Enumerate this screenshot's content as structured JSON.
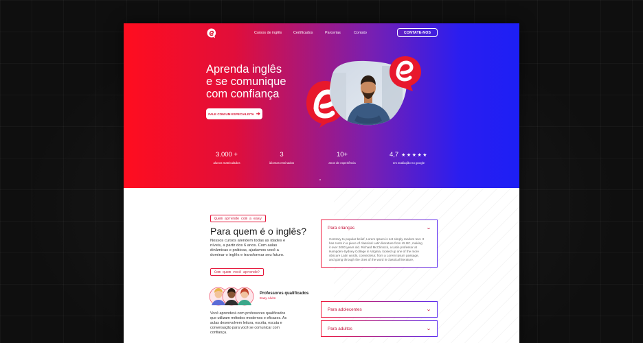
{
  "nav": {
    "links": [
      "Cursos de inglês",
      "Certificados",
      "Parcerias",
      "Contato"
    ],
    "cta": "CONTATE-NOS"
  },
  "hero": {
    "title_lines": [
      "Aprenda inglês",
      "e se comunique",
      "com confiança"
    ],
    "button": "FALE COM UM ESPECIALISTA",
    "button_icon": "arrow-right-icon"
  },
  "stats": [
    {
      "value": "3.000 +",
      "label": "alunos matriculados"
    },
    {
      "value": "3",
      "label": "idiomas ensinados"
    },
    {
      "value": "10+",
      "label": "anos de  experiência"
    },
    {
      "value": "4,7",
      "stars": "★★★★★",
      "label": "em avaliação no google"
    }
  ],
  "section": {
    "tag1": "Quem aprende com a easy",
    "title": "Para quem é o inglês?",
    "desc": "Nossos cursos atendem todas as idades e níveis, a partir dos 6 anos. Com aulas dinâmicas e práticas, ajudamos você a dominar o inglês e transformar seu futuro.",
    "tag2": "Com quem você aprende?",
    "prof_title": "Professores qualificados",
    "prof_sub": "Easy Alvim",
    "prof_desc": "Você aprenderá com professores qualificados que utilizam métodos modernos e eficazes. As aulas desenvolvem leitura, escrita, escuta e conversação para você se comunicar com confiança."
  },
  "accordion": [
    {
      "label": "Para crianças",
      "expanded": true,
      "body": "Contrary to popular belief, Lorem Ipsum is not simply random text. It has roots in a piece of classical Latin literature from 45 BC, making it over 2000 years old. Richard McClintock, a Latin professor at Hampden-Sydney College in Virginia, looked up one of the more obscure Latin words, consectetur, from a Lorem Ipsum passage, and going through the cites of the word in classical literature,"
    },
    {
      "label": "Para adolecentes",
      "expanded": false
    },
    {
      "label": "Para adultos",
      "expanded": false
    }
  ],
  "colors": {
    "accent": "#e5163a",
    "blue": "#1d1ff5"
  }
}
